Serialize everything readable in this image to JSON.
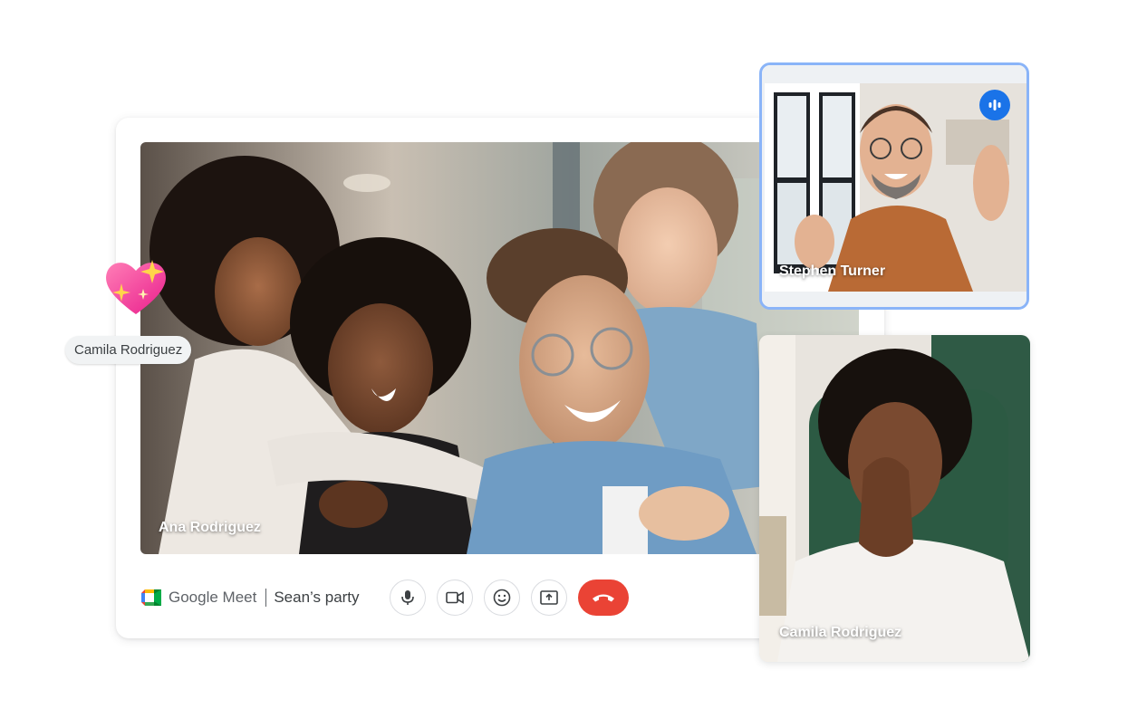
{
  "main_video": {
    "participant": "Ana Rodriguez"
  },
  "reaction": {
    "name": "Camila Rodriguez",
    "emoji": "sparkling-heart"
  },
  "brand": {
    "name": "Google Meet",
    "meeting_title": "Sean’s party"
  },
  "controls": [
    {
      "id": "microphone",
      "icon": "mic-icon"
    },
    {
      "id": "camera",
      "icon": "videocam-icon"
    },
    {
      "id": "reactions",
      "icon": "emoji-icon"
    },
    {
      "id": "present",
      "icon": "present-screen-icon"
    },
    {
      "id": "leave-call",
      "icon": "call-end-icon",
      "color": "#ea4335"
    }
  ],
  "tiles": [
    {
      "participant": "Stephen Turner",
      "speaking": true,
      "highlight_color": "#8ab4f8"
    },
    {
      "participant": "Camila Rodriguez",
      "speaking": false
    }
  ],
  "colors": {
    "accent": "#1a73e8",
    "end_call": "#ea4335",
    "chip_bg": "#f1f3f4"
  }
}
